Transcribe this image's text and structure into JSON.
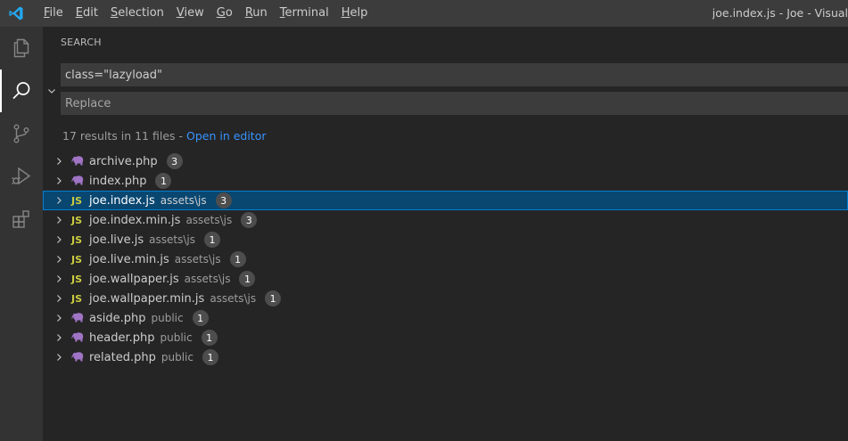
{
  "menu": [
    {
      "key": "F",
      "rest": "ile"
    },
    {
      "key": "E",
      "rest": "dit"
    },
    {
      "key": "S",
      "rest": "election"
    },
    {
      "key": "V",
      "rest": "iew"
    },
    {
      "key": "G",
      "rest": "o"
    },
    {
      "key": "R",
      "rest": "un"
    },
    {
      "key": "T",
      "rest": "erminal"
    },
    {
      "key": "H",
      "rest": "elp"
    }
  ],
  "window_title": "joe.index.js - Joe - Visual",
  "search": {
    "title": "SEARCH",
    "query": "class=\"lazyload\"",
    "replace_placeholder": "Replace",
    "summary": "17 results in 11 files - ",
    "open_in_editor": "Open in editor"
  },
  "results": [
    {
      "name": "archive.php",
      "path": "",
      "count": "3",
      "type": "php"
    },
    {
      "name": "index.php",
      "path": "",
      "count": "1",
      "type": "php"
    },
    {
      "name": "joe.index.js",
      "path": "assets\\js",
      "count": "3",
      "type": "js",
      "selected": true
    },
    {
      "name": "joe.index.min.js",
      "path": "assets\\js",
      "count": "3",
      "type": "js"
    },
    {
      "name": "joe.live.js",
      "path": "assets\\js",
      "count": "1",
      "type": "js"
    },
    {
      "name": "joe.live.min.js",
      "path": "assets\\js",
      "count": "1",
      "type": "js"
    },
    {
      "name": "joe.wallpaper.js",
      "path": "assets\\js",
      "count": "1",
      "type": "js"
    },
    {
      "name": "joe.wallpaper.min.js",
      "path": "assets\\js",
      "count": "1",
      "type": "js"
    },
    {
      "name": "aside.php",
      "path": "public",
      "count": "1",
      "type": "php"
    },
    {
      "name": "header.php",
      "path": "public",
      "count": "1",
      "type": "php"
    },
    {
      "name": "related.php",
      "path": "public",
      "count": "1",
      "type": "php"
    }
  ],
  "js_label": "JS",
  "colors": {
    "accent": "#007fd4",
    "selection": "#094771",
    "link": "#3794ff",
    "js": "#cbcb41",
    "php": "#a074c4"
  }
}
